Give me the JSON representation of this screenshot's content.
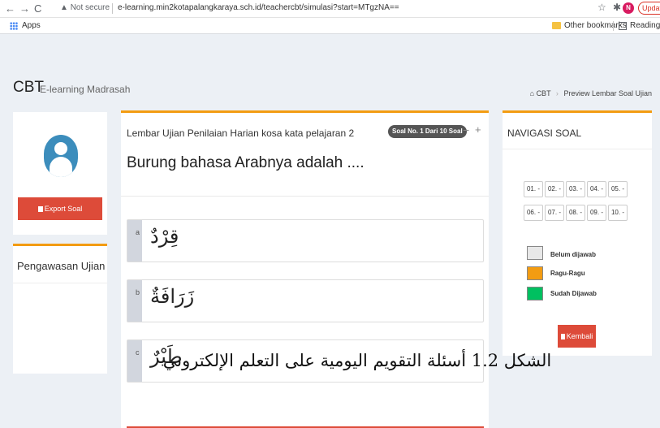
{
  "browser": {
    "not_secure": "Not secure",
    "url": "e-learning.min2kotapalangkaraya.sch.id/teachercbt/simulasi?start=MTgzNA==",
    "profile_initial": "N",
    "update_label": "Update",
    "apps_label": "Apps",
    "bookmark_other": "Other bookmarks",
    "bookmark_reading": "Reading list"
  },
  "header": {
    "title": "CBT",
    "subtitle": "E-learning Madrasah",
    "breadcrumb": [
      "CBT",
      "Preview Lembar Soal Ujian"
    ]
  },
  "sidebar": {
    "export_label": "Export Soal",
    "pengawasan_title": "Pengawasan Ujian"
  },
  "main": {
    "heading": "Lembar Ujian Penilaian Harian kosa kata pelajaran 2",
    "badge": "Soal No. 1 Dari 10 Soal",
    "question": "Burung bahasa Arabnya adalah ....",
    "options": [
      {
        "letter": "a",
        "text": "قِرْدٌ"
      },
      {
        "letter": "b",
        "text": "زَرَافَةٌ"
      },
      {
        "letter": "c",
        "text": "طَيْرٌ"
      }
    ]
  },
  "navigation": {
    "title": "NAVIGASI SOAL",
    "numbers": [
      "01. -",
      "02. -",
      "03. -",
      "04. -",
      "05. -",
      "06. -",
      "07. -",
      "08. -",
      "09. -",
      "10. -"
    ],
    "legend": [
      {
        "label": "Belum dijawab",
        "color": "#e8e8e8"
      },
      {
        "label": "Ragu-Ragu",
        "color": "#f39c12"
      },
      {
        "label": "Sudah Dijawab",
        "color": "#00c060"
      }
    ],
    "back_label": "Kembali"
  },
  "caption": "الشكل 1.2 أسئلة التقويم اليومية على التعلم الإلكتروني"
}
